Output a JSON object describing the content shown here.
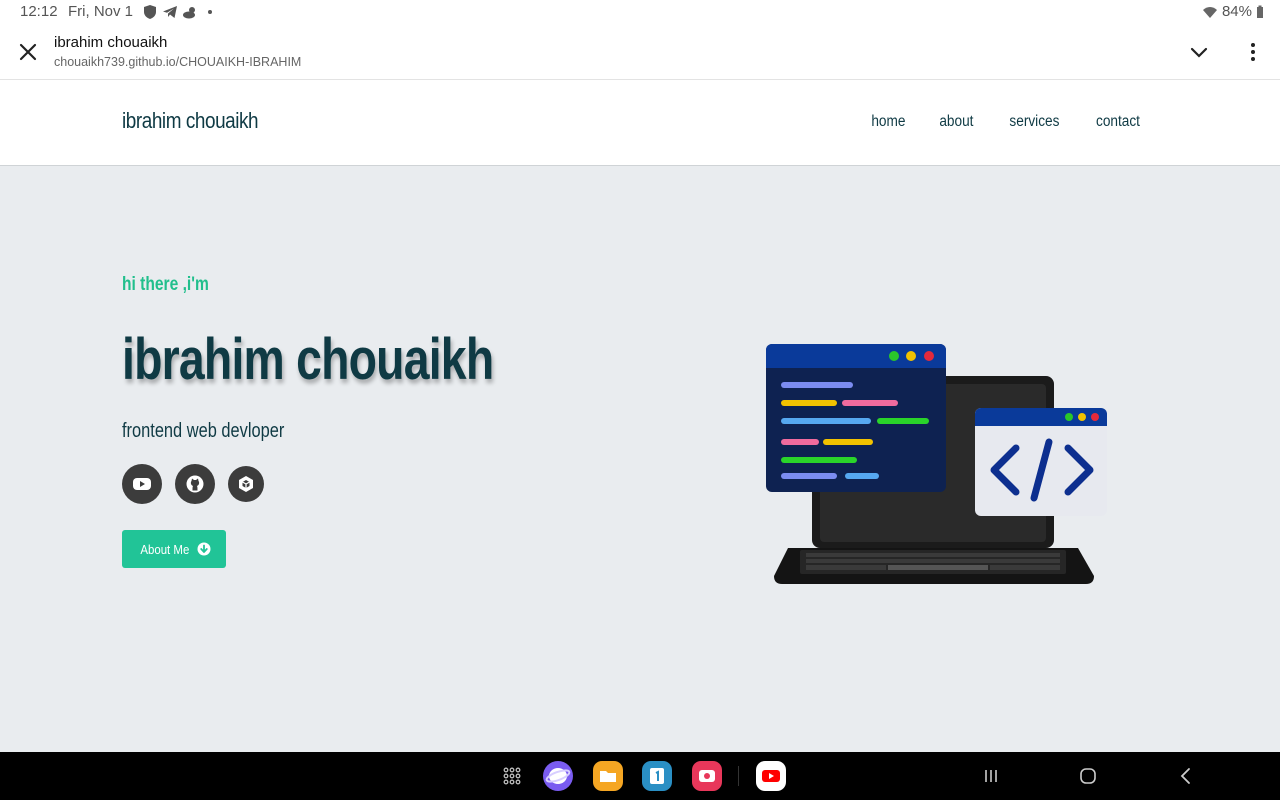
{
  "status": {
    "time": "12:12",
    "date": "Fri, Nov 1",
    "battery": "84%"
  },
  "browser": {
    "title": "ibrahim chouaikh",
    "url": "chouaikh739.github.io/CHOUAIKH-IBRAHIM"
  },
  "site": {
    "logo": "ibrahim chouaikh",
    "nav": [
      "home",
      "about",
      "services",
      "contact"
    ]
  },
  "hero": {
    "greeting": "hi there ,i'm",
    "name": "ibrahim chouaikh",
    "role": "frontend web devloper",
    "cta_label": "About Me",
    "socials": [
      "youtube-icon",
      "github-icon",
      "unity-icon"
    ]
  },
  "colors": {
    "accent": "#21c497",
    "brand_dark": "#0f3a44",
    "hero_bg": "#e9ecef"
  }
}
